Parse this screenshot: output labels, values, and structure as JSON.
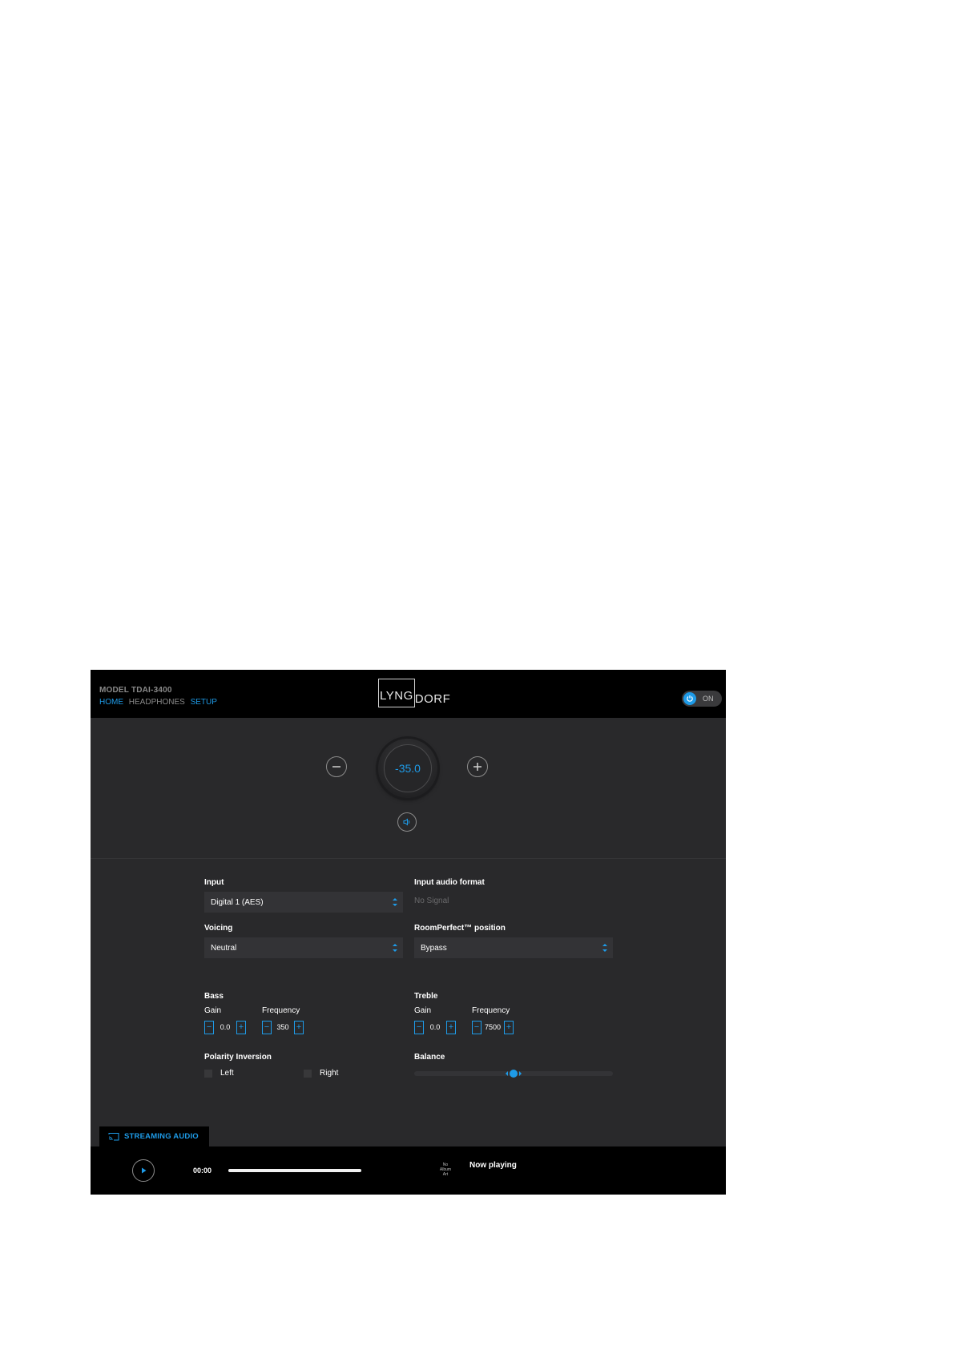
{
  "header": {
    "model": "MODEL TDAI-3400",
    "nav": [
      "HOME",
      "HEADPHONES",
      "SETUP"
    ],
    "logo_boxed": "LYNG",
    "logo_tail": "DORF",
    "power_label": "ON"
  },
  "volume": {
    "value": "-35.0"
  },
  "controls": {
    "input_label": "Input",
    "input_value": "Digital 1 (AES)",
    "format_label": "Input audio format",
    "format_value": "No Signal",
    "voicing_label": "Voicing",
    "voicing_value": "Neutral",
    "roomperfect_label": "RoomPerfect™ position",
    "roomperfect_value": "Bypass",
    "bass_label": "Bass",
    "bass_gain_label": "Gain",
    "bass_gain": "0.0",
    "bass_freq_label": "Frequency",
    "bass_freq": "350",
    "treble_label": "Treble",
    "treble_gain_label": "Gain",
    "treble_gain": "0.0",
    "treble_freq_label": "Frequency",
    "treble_freq": "7500",
    "polarity_label": "Polarity Inversion",
    "polarity_left": "Left",
    "polarity_right": "Right",
    "balance_label": "Balance",
    "balance_value": 0.5
  },
  "player": {
    "tab_label": "STREAMING AUDIO",
    "time": "00:00",
    "progress": 1.0,
    "album_art_placeholder": "No Album Art",
    "now_playing": "Now playing"
  },
  "colors": {
    "accent": "#1e9be8",
    "panel": "#29292b",
    "bar": "#000000"
  }
}
